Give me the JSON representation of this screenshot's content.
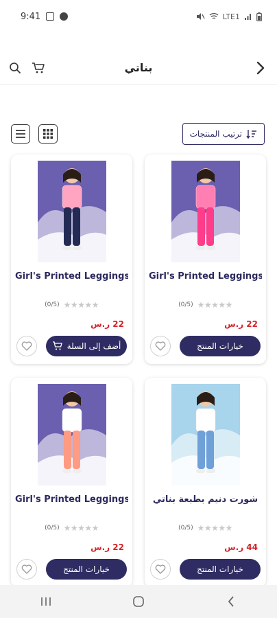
{
  "status_bar": {
    "time": "9:41",
    "net_label": "LTE1"
  },
  "header": {
    "title": "بناتي"
  },
  "toolbar": {
    "sort_label": "ترتيب المنتجات"
  },
  "products": [
    {
      "name": "Girl's Printed Leggings",
      "rating_text": "(0/5)",
      "price": "22 ر.س",
      "action_label": "خيارات المنتج",
      "shirt_color": "#ff7fb3",
      "pants_color": "#ff3d8a",
      "bg_color": "#6b5fb0"
    },
    {
      "name": "Girl's Printed Leggings",
      "rating_text": "(0/5)",
      "price": "22 ر.س",
      "action_label": "أضف إلى السلة",
      "shirt_color": "#ffa5c2",
      "pants_color": "#232b55",
      "bg_color": "#6b5fb0"
    },
    {
      "name": "شورت دنيم بطبعة بناتي",
      "rating_text": "(0/5)",
      "price": "44 ر.س",
      "action_label": "خيارات المنتج",
      "shirt_color": "#ffffff",
      "pants_color": "#6fa0d8",
      "bg_color": "#a8d4ec"
    },
    {
      "name": "Girl's Printed Leggings",
      "rating_text": "(0/5)",
      "price": "22 ر.س",
      "action_label": "خيارات المنتج",
      "shirt_color": "#ffffff",
      "pants_color": "#ff9a83",
      "bg_color": "#6b5fb0"
    }
  ],
  "colors": {
    "brand": "#2f2c63",
    "price": "#d4232a",
    "star": "#c9c9c9"
  }
}
